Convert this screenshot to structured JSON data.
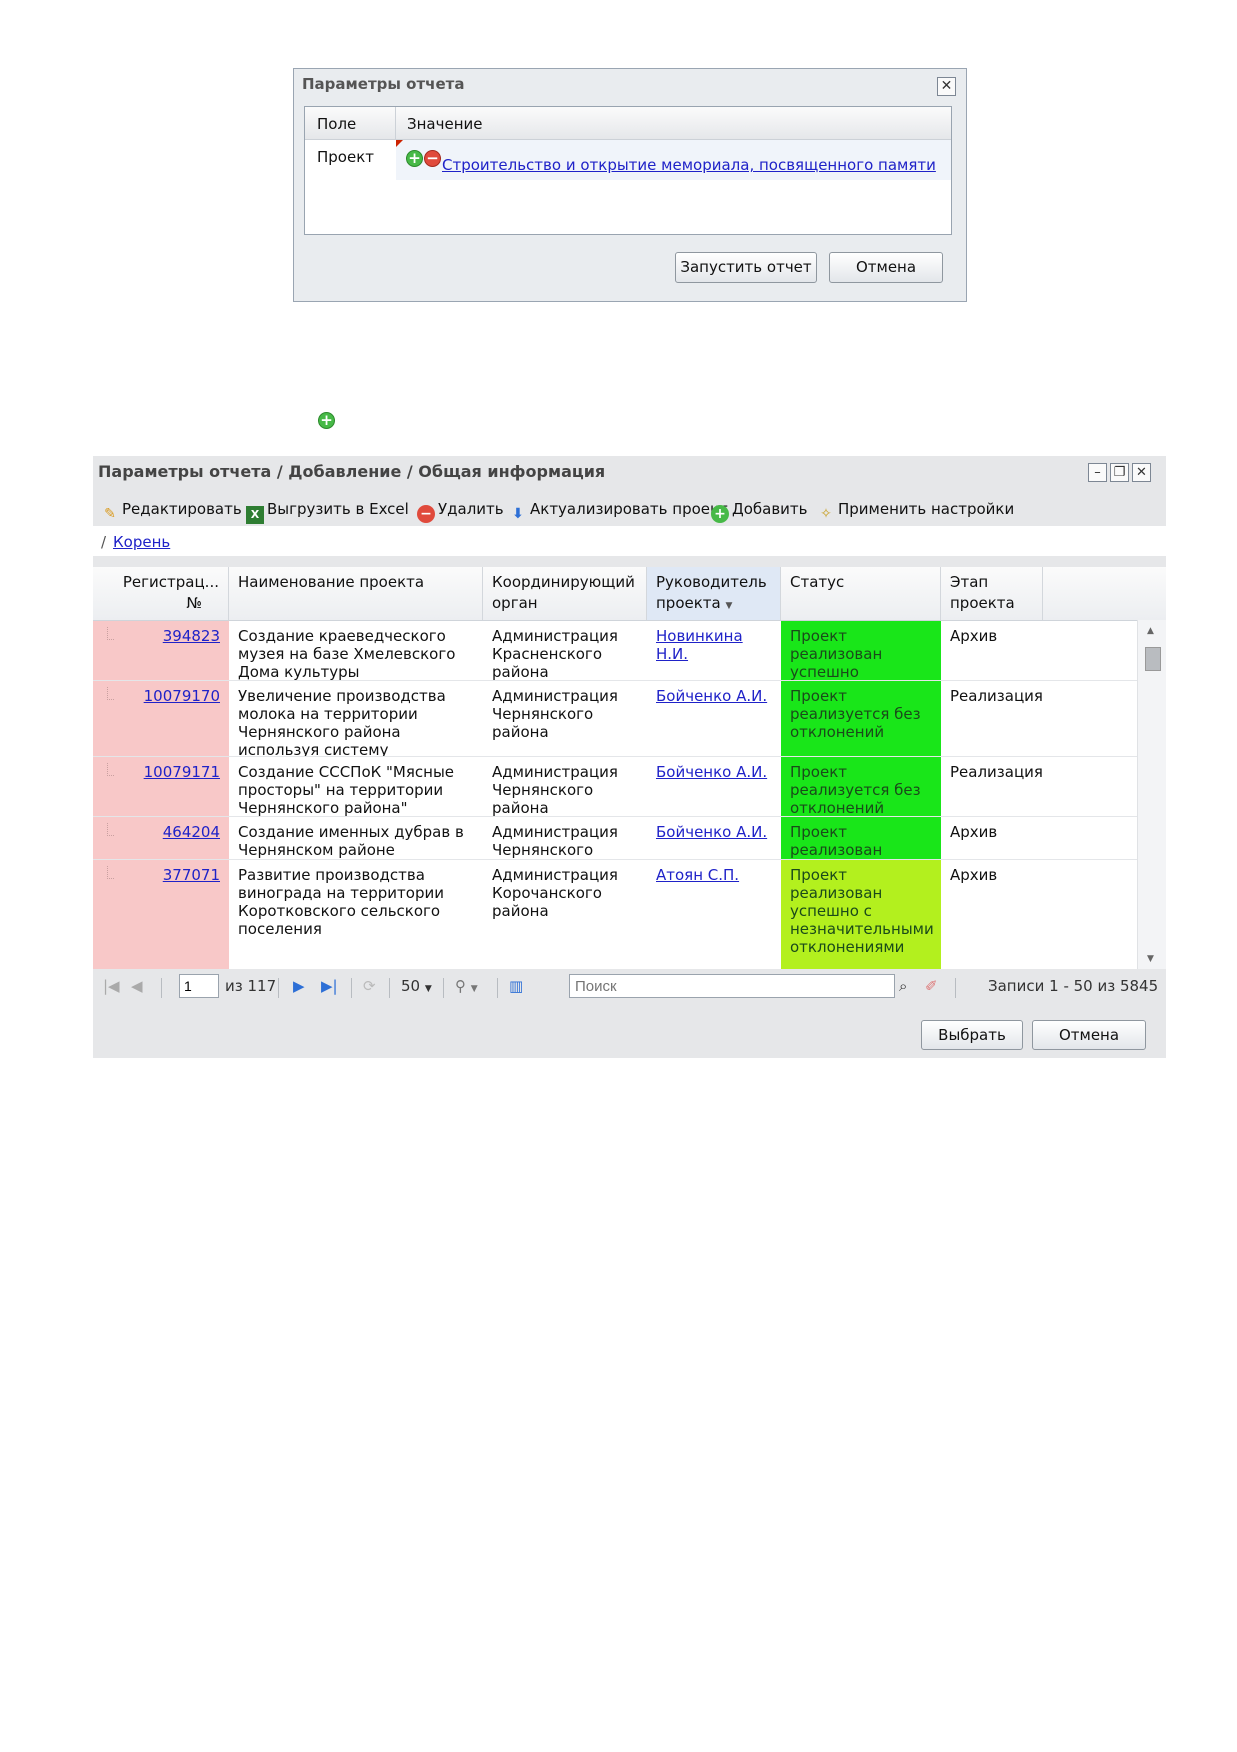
{
  "dialog1": {
    "title": "Параметры отчета",
    "col_field": "Поле",
    "col_value": "Значение",
    "row_label": "Проект",
    "row_value": "Строительство и открытие мемориала, посвященного памяти",
    "run_button": "Запустить отчет",
    "cancel_button": "Отмена"
  },
  "window": {
    "title": "Параметры отчета / Добавление / Общая информация",
    "toolbar": {
      "edit": "Редактировать",
      "export": "Выгрузить в Excel",
      "delete": "Удалить",
      "actualize": "Актуализировать проект",
      "add": "Добавить",
      "apply": "Применить настройки"
    },
    "breadcrumb_sep": "/",
    "breadcrumb_root": "Корень",
    "columns": {
      "reg": "Регистрац...",
      "reg2": "№",
      "name": "Наименование проекта",
      "organ": "Координирующий орган",
      "lead": "Руководитель проекта",
      "status": "Статус",
      "stage": "Этап проекта"
    },
    "rows": [
      {
        "reg": "394823",
        "name": "Создание краеведческого музея на базе Хмелевского Дома культуры",
        "organ": "Администрация Красненского района",
        "lead": "Новинкина Н.И.",
        "status": "Проект реализован успешно",
        "stage": "Архив",
        "status_color": "#19e619"
      },
      {
        "reg": "10079170",
        "name": "Увеличение производства молока на территории Чернянского района используя систему интеграции малого и крупного бизнеса",
        "organ": "Администрация Чернянского района",
        "lead": "Бойченко А.И.",
        "status": "Проект реализуется без отклонений",
        "stage": "Реализация",
        "status_color": "#19e619"
      },
      {
        "reg": "10079171",
        "name": "Создание СССПоК \"Мясные просторы\" на территории Чернянского района\"",
        "organ": "Администрация Чернянского района",
        "lead": "Бойченко А.И.",
        "status": "Проект реализуется без отклонений",
        "stage": "Реализация",
        "status_color": "#19e619"
      },
      {
        "reg": "464204",
        "name": "Создание именных дубрав в Чернянском районе",
        "organ": "Администрация Чернянского района",
        "lead": "Бойченко А.И.",
        "status": "Проект реализован успешно",
        "stage": "Архив",
        "status_color": "#19e619"
      },
      {
        "reg": "377071",
        "name": "Развитие производства винограда на территории Коротковского сельского поселения",
        "organ": "Администрация Корочанского района",
        "lead": "Атоян С.П.",
        "status": "Проект реализован успешно с незначительными отклонениями",
        "stage": "Архив",
        "status_color": "#b3f01e"
      }
    ],
    "pager": {
      "page": "1",
      "of_pages": "из 117",
      "page_size": "50",
      "search_placeholder": "Поиск",
      "records": "Записи 1 - 50 из 5845"
    },
    "choose_button": "Выбрать",
    "cancel_button": "Отмена"
  }
}
